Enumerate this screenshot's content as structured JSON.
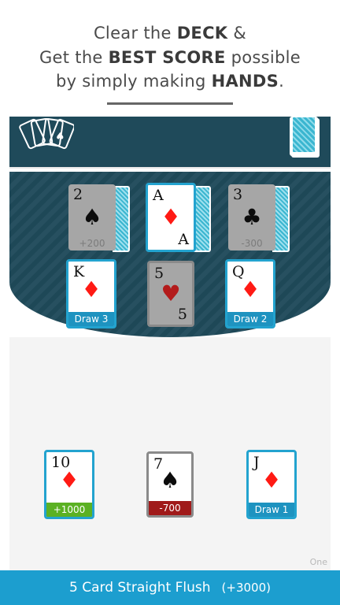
{
  "header": {
    "line1_pre": "Clear the ",
    "line1_bold": "DECK",
    "line1_post": " &",
    "line2_pre": "Get the ",
    "line2_bold": "BEST SCORE",
    "line2_post": " possible",
    "line3_pre": "by simply making ",
    "line3_bold": "HANDS",
    "line3_post": "."
  },
  "board": {
    "row1": [
      {
        "rank": "2",
        "suit": "♠",
        "tag": "+200"
      },
      {
        "rank": "A",
        "suit": "♦"
      },
      {
        "rank": "3",
        "suit": "♣",
        "tag": "-300"
      }
    ],
    "row2": [
      {
        "rank": "K",
        "suit": "♦",
        "tag": "Draw 3"
      },
      {
        "rank": "5",
        "suit": "♥"
      },
      {
        "rank": "Q",
        "suit": "♦",
        "tag": "Draw 2"
      }
    ],
    "hand": [
      {
        "rank": "10",
        "suit": "♦",
        "tag": "+1000"
      },
      {
        "rank": "7",
        "suit": "♠",
        "tag": "-700"
      },
      {
        "rank": "J",
        "suit": "♦",
        "tag": "Draw 1"
      }
    ]
  },
  "footer": {
    "hand_name": "5 Card Straight Flush",
    "bonus": "(+3000)",
    "corner_label": "One"
  },
  "colors": {
    "table": "#1f4a5a",
    "accent": "#1c9ecf",
    "red_suit": "#ff1a14",
    "positive": "#5bb123",
    "negative": "#a01a1a"
  }
}
